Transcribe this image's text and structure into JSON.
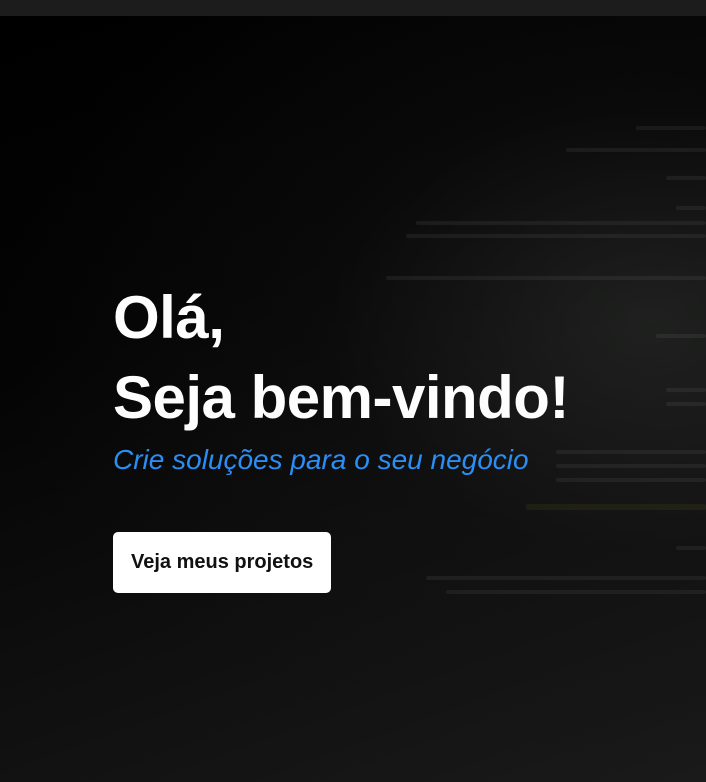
{
  "hero": {
    "greeting_line1": "Olá,",
    "greeting_line2": "Seja bem-vindo!",
    "subtitle": "Crie soluções para o seu negócio",
    "cta_label": "Veja meus projetos"
  },
  "colors": {
    "accent": "#2b8ef5",
    "background": "#000000",
    "button_bg": "#ffffff"
  }
}
